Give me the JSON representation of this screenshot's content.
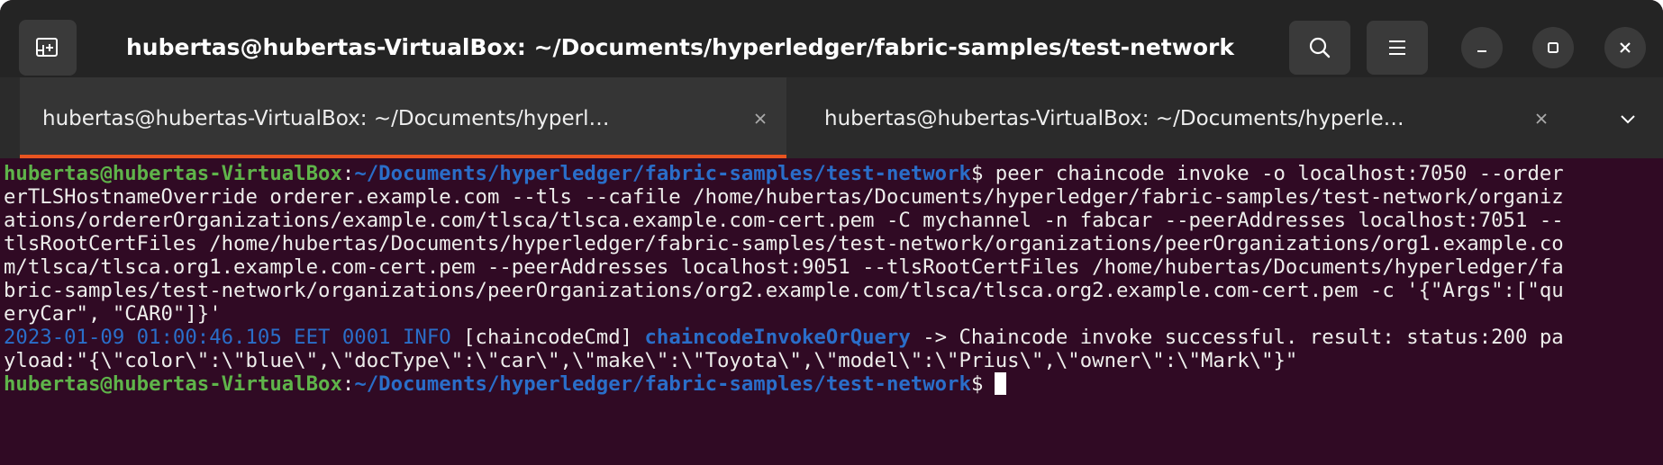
{
  "window": {
    "title": "hubertas@hubertas-VirtualBox: ~/Documents/hyperledger/fabric-samples/test-network"
  },
  "toolbar": {
    "new_tab_icon": "new-tab-icon",
    "search_icon": "search-icon",
    "menu_icon": "hamburger-menu-icon",
    "minimize_icon": "minimize-icon",
    "maximize_icon": "maximize-icon",
    "close_icon": "close-icon"
  },
  "tabs": [
    {
      "label": "hubertas@hubertas-VirtualBox: ~/Documents/hyperl…",
      "active": true
    },
    {
      "label": "hubertas@hubertas-VirtualBox: ~/Documents/hyperle…",
      "active": false
    }
  ],
  "terminal": {
    "prompt_user": "hubertas@hubertas-VirtualBox",
    "prompt_sep": ":",
    "prompt_path": "~/Documents/hyperledger/fabric-samples/test-network",
    "prompt_symbol": "$",
    "command_lines": [
      " peer chaincode invoke -o localhost:7050 --order",
      "erTLSHostnameOverride orderer.example.com --tls --cafile /home/hubertas/Documents/hyperledger/fabric-samples/test-network/organiz",
      "ations/ordererOrganizations/example.com/tlsca/tlsca.example.com-cert.pem -C mychannel -n fabcar --peerAddresses localhost:7051 --",
      "tlsRootCertFiles /home/hubertas/Documents/hyperledger/fabric-samples/test-network/organizations/peerOrganizations/org1.example.co",
      "m/tlsca/tlsca.org1.example.com-cert.pem --peerAddresses localhost:9051 --tlsRootCertFiles /home/hubertas/Documents/hyperledger/fa",
      "bric-samples/test-network/organizations/peerOrganizations/org2.example.com/tlsca/tlsca.org2.example.com-cert.pem -c '{\"Args\":[\"qu",
      "eryCar\", \"CAR0\"]}'"
    ],
    "log_timestamp": "2023-01-09 01:00:46.105 EET 0001 INFO",
    "log_component": " [chaincodeCmd] ",
    "log_function": "chaincodeInvokeOrQuery",
    "log_message": " -> Chaincode invoke successful. result: status:200 pa",
    "log_continuation": "yload:\"{\\\"color\\\":\\\"blue\\\",\\\"docType\\\":\\\"car\\\",\\\"make\\\":\\\"Toyota\\\",\\\"model\\\":\\\"Prius\\\",\\\"owner\\\":\\\"Mark\\\"}\""
  },
  "colors": {
    "background": "#300a24",
    "user": "#5fb44a",
    "path": "#2a6ec9",
    "accent": "#e95420"
  }
}
